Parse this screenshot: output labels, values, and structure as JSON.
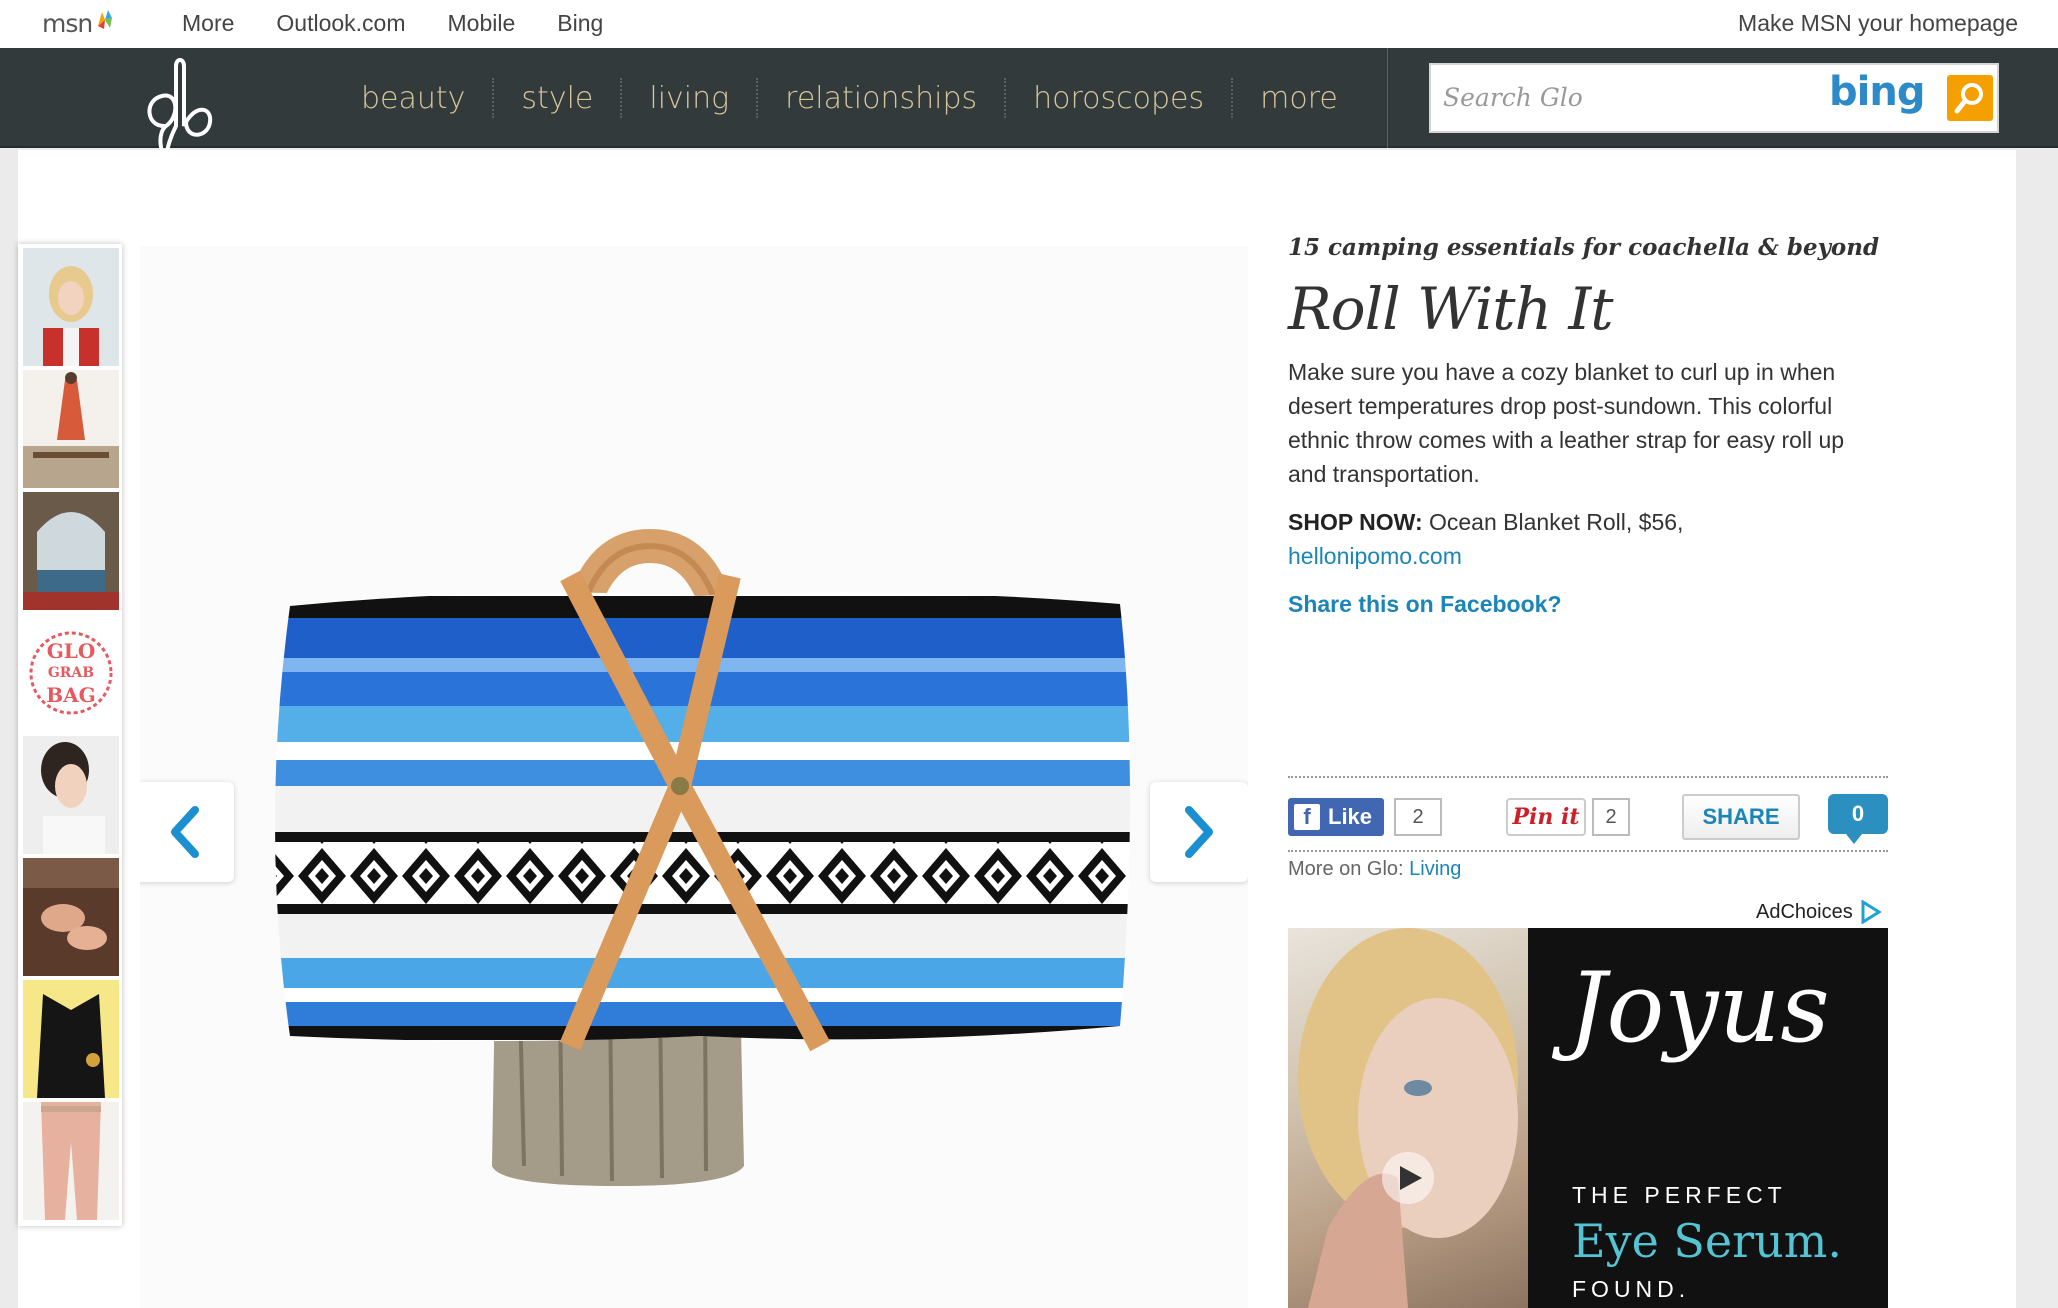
{
  "msnbar": {
    "logo": "msn",
    "links": [
      "More",
      "Outlook.com",
      "Mobile",
      "Bing"
    ],
    "homepage_link": "Make MSN your homepage"
  },
  "header": {
    "logo": "glo",
    "nav": [
      "beauty",
      "style",
      "living",
      "relationships",
      "horoscopes",
      "more"
    ],
    "search_placeholder": "Search Glo",
    "search_brand": "bing"
  },
  "thumbnails": [
    {
      "label": "woman-red-jacket"
    },
    {
      "label": "red-dress-outdoor"
    },
    {
      "label": "archway-view"
    },
    {
      "label": "glo-grab-bag",
      "text": [
        "GLO",
        "GRAB",
        "BAG"
      ]
    },
    {
      "label": "woman-eating"
    },
    {
      "label": "typewriter-hands"
    },
    {
      "label": "black-blazer"
    },
    {
      "label": "pink-pants"
    }
  ],
  "article": {
    "kicker": "15 camping essentials for coachella & beyond",
    "title": "Roll With It",
    "description": "Make sure you have a cozy blanket to curl up in when desert temperatures drop post-sundown. This colorful ethnic throw comes with a leather strap for easy roll up and transportation.",
    "shop_label": "SHOP NOW:",
    "shop_text": " Ocean Blanket Roll, $56,",
    "shop_link": "hellonipomo.com",
    "facebook_share": "Share this on Facebook?"
  },
  "social": {
    "like_label": "Like",
    "like_count": "2",
    "pin_label": "Pin it",
    "pin_count": "2",
    "share_label": "SHARE",
    "comment_count": "0"
  },
  "more_on": {
    "label": "More on Glo:",
    "link": "Living"
  },
  "ad": {
    "adchoices": "AdChoices",
    "brand": "Joyus",
    "line1": "THE PERFECT",
    "line2": "Eye Serum.",
    "line3": "FOUND."
  },
  "colors": {
    "header_bg": "#333a3c",
    "nav_text": "#d7c69b",
    "link": "#1b85b8",
    "bing_blue": "#2c8ac8",
    "bing_orange": "#f5a000"
  }
}
